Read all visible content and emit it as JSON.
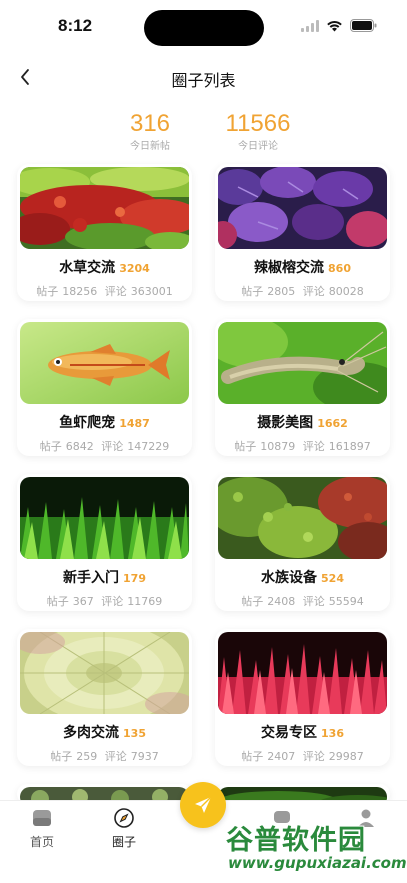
{
  "status_bar": {
    "time": "8:12"
  },
  "nav": {
    "title": "圈子列表"
  },
  "stats": [
    {
      "value": "316",
      "label": "今日新帖"
    },
    {
      "value": "11566",
      "label": "今日评论"
    }
  ],
  "circles": [
    {
      "name": "水草交流",
      "count": "3204",
      "posts_label": "帖子",
      "posts": "18256",
      "comments_label": "评论",
      "comments": "363001"
    },
    {
      "name": "辣椒榕交流",
      "count": "860",
      "posts_label": "帖子",
      "posts": "2805",
      "comments_label": "评论",
      "comments": "80028"
    },
    {
      "name": "鱼虾爬宠",
      "count": "1487",
      "posts_label": "帖子",
      "posts": "6842",
      "comments_label": "评论",
      "comments": "147229"
    },
    {
      "name": "摄影美图",
      "count": "1662",
      "posts_label": "帖子",
      "posts": "10879",
      "comments_label": "评论",
      "comments": "161897"
    },
    {
      "name": "新手入门",
      "count": "179",
      "posts_label": "帖子",
      "posts": "367",
      "comments_label": "评论",
      "comments": "11769"
    },
    {
      "name": "水族设备",
      "count": "524",
      "posts_label": "帖子",
      "posts": "2408",
      "comments_label": "评论",
      "comments": "55594"
    },
    {
      "name": "多肉交流",
      "count": "135",
      "posts_label": "帖子",
      "posts": "259",
      "comments_label": "评论",
      "comments": "7937"
    },
    {
      "name": "交易专区",
      "count": "136",
      "posts_label": "帖子",
      "posts": "2407",
      "comments_label": "评论",
      "comments": "29987"
    }
  ],
  "tabs": [
    {
      "label": "首页",
      "icon": "home-icon"
    },
    {
      "label": "圈子",
      "icon": "compass-icon"
    }
  ],
  "fab_icon": "send-icon",
  "watermark": {
    "main": "谷普软件园",
    "url": "www.gupuxiazai.com"
  },
  "colors": {
    "accent": "#f0a333",
    "fab": "#f7c21c",
    "watermark": "#2a8a3c"
  }
}
